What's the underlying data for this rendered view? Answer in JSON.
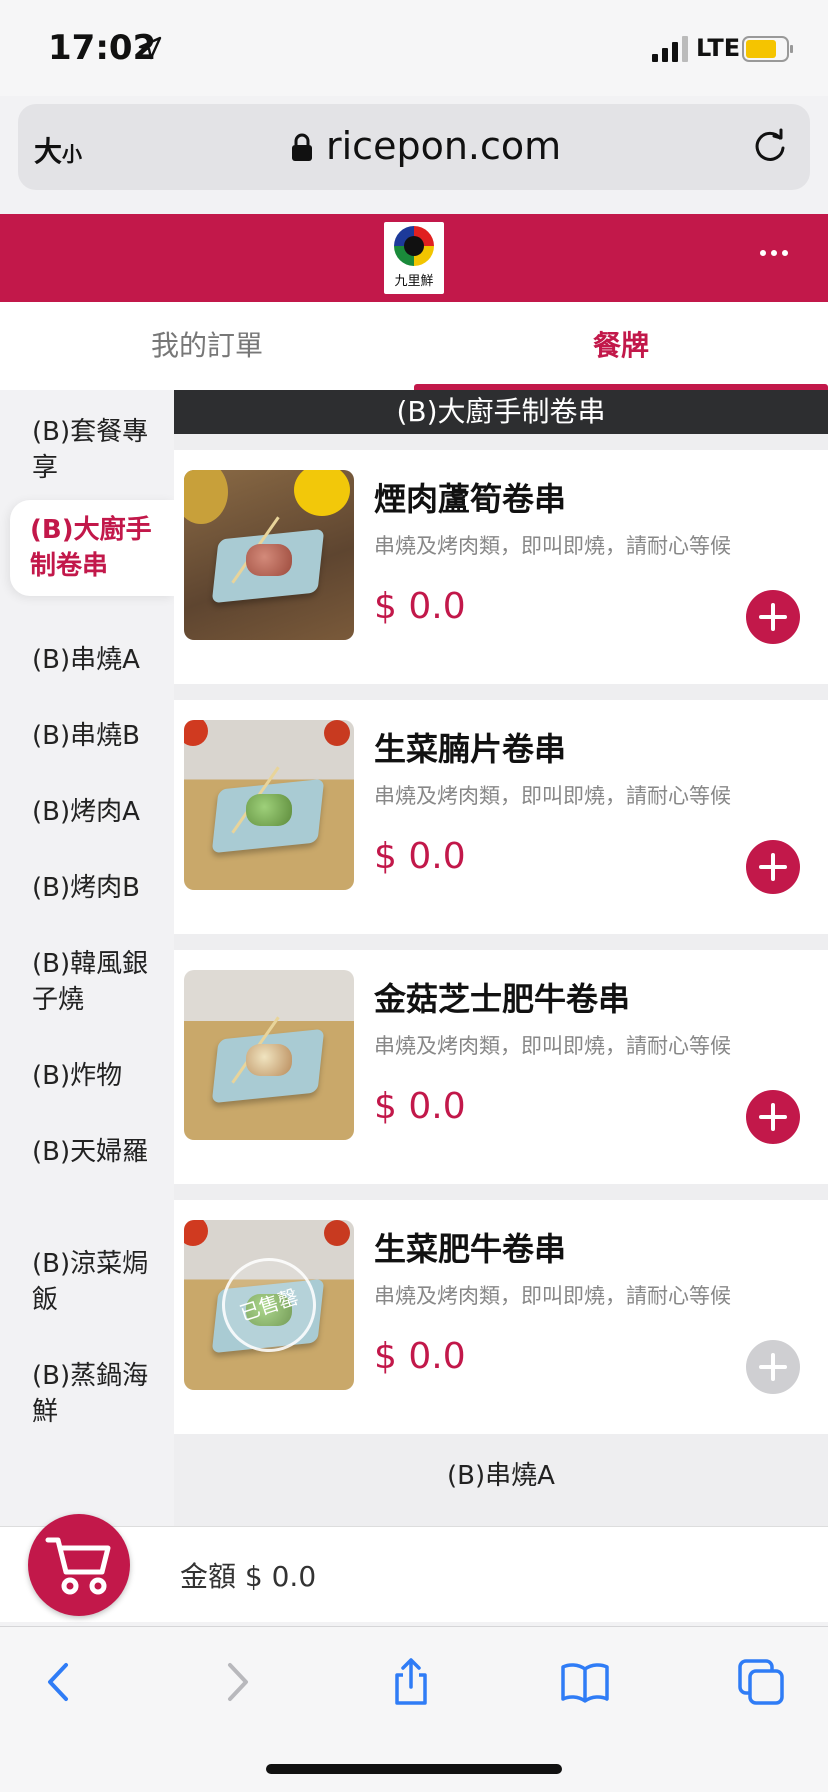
{
  "status_bar": {
    "time": "17:02",
    "network": "LTE"
  },
  "browser": {
    "text_size_label": "大",
    "text_size_small": "小",
    "url": "ricepon.com"
  },
  "header": {
    "logo_text": "九里鮮",
    "accent_color": "#c2184a"
  },
  "tabs": [
    {
      "label": "我的訂單",
      "active": false
    },
    {
      "label": "餐牌",
      "active": true
    }
  ],
  "sidebar": {
    "categories": [
      {
        "label": "(B)套餐專享"
      },
      {
        "label": "(B)大廚手制卷串",
        "active": true
      },
      {
        "label": "(B)串燒A"
      },
      {
        "label": "(B)串燒B"
      },
      {
        "label": "(B)烤肉A"
      },
      {
        "label": "(B)烤肉B"
      },
      {
        "label": "(B)韓風銀子燒"
      },
      {
        "label": "(B)炸物"
      },
      {
        "label": "(B)天婦羅"
      },
      {
        "label": "(B)涼菜焗飯"
      },
      {
        "label": "(B)蒸鍋海鮮"
      }
    ]
  },
  "menu": {
    "section_title": "(B)大廚手制卷串",
    "next_section_title": "(B)串燒A",
    "items": [
      {
        "name": "煙肉蘆筍卷串",
        "desc": "串燒及烤肉類，即叫即燒，請耐心等候",
        "price": "$ 0.0",
        "available": true
      },
      {
        "name": "生菜腩片卷串",
        "desc": "串燒及烤肉類，即叫即燒，請耐心等候",
        "price": "$ 0.0",
        "available": true
      },
      {
        "name": "金菇芝士肥牛卷串",
        "desc": "串燒及烤肉類，即叫即燒，請耐心等候",
        "price": "$ 0.0",
        "available": true
      },
      {
        "name": "生菜肥牛卷串",
        "desc": "串燒及烤肉類，即叫即燒，請耐心等候",
        "price": "$ 0.0",
        "available": false,
        "badge": "已售罄"
      }
    ]
  },
  "cart": {
    "amount_label": "金額 $ 0.0"
  }
}
